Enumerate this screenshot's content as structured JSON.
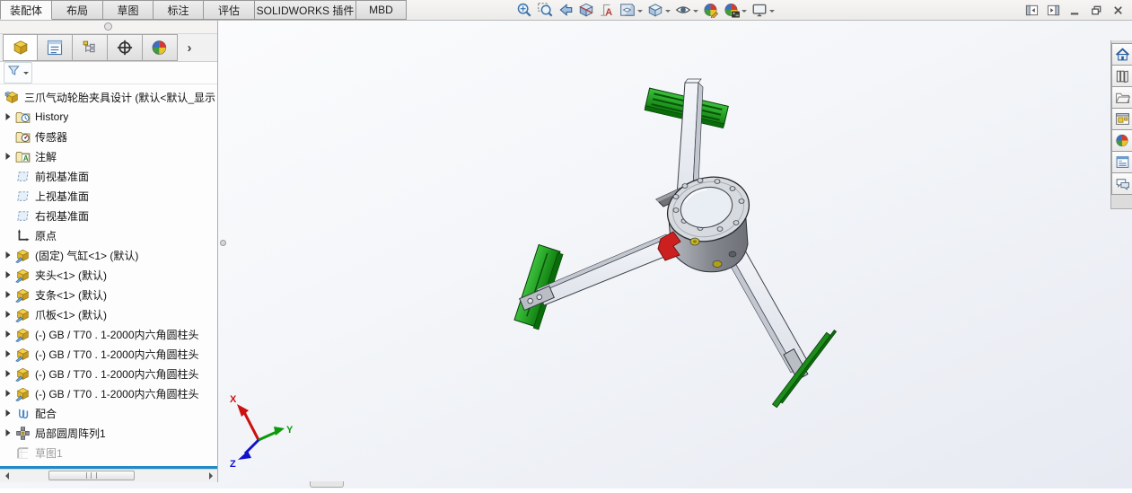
{
  "ribbon": {
    "tabs": [
      {
        "id": "assembly",
        "label": "装配体",
        "active": true
      },
      {
        "id": "layout",
        "label": "布局",
        "active": false
      },
      {
        "id": "sketch",
        "label": "草图",
        "active": false
      },
      {
        "id": "markup",
        "label": "标注",
        "active": false
      },
      {
        "id": "evaluate",
        "label": "评估",
        "active": false
      },
      {
        "id": "solidworks-addins",
        "label": "SOLIDWORKS 插件",
        "active": false
      },
      {
        "id": "mbd",
        "label": "MBD",
        "active": false
      }
    ]
  },
  "headsup": {
    "buttons": [
      {
        "id": "zoom-to-fit",
        "icon": "zoom-fit-icon",
        "dropdown": false
      },
      {
        "id": "zoom-to-area",
        "icon": "zoom-area-icon",
        "dropdown": false
      },
      {
        "id": "previous-view",
        "icon": "previous-view-icon",
        "dropdown": false
      },
      {
        "id": "section-view",
        "icon": "section-view-icon",
        "dropdown": false
      },
      {
        "id": "dynamic-annotation-views",
        "icon": "annotation-view-icon",
        "dropdown": false
      },
      {
        "id": "view-orientation",
        "icon": "view-orientation-icon",
        "dropdown": true
      },
      {
        "id": "display-style",
        "icon": "display-style-icon",
        "dropdown": true
      },
      {
        "id": "hide-show-items",
        "icon": "hide-show-items-icon",
        "dropdown": true
      },
      {
        "id": "edit-appearance",
        "icon": "edit-appearance-icon",
        "dropdown": false
      },
      {
        "id": "apply-scene",
        "icon": "apply-scene-icon",
        "dropdown": true
      },
      {
        "id": "view-settings",
        "icon": "view-settings-icon",
        "dropdown": true
      }
    ]
  },
  "window": {
    "controls": [
      {
        "id": "collapse-pane-left",
        "icon": "pane-left-icon"
      },
      {
        "id": "collapse-pane-right",
        "icon": "pane-right-icon"
      },
      {
        "id": "minimize",
        "icon": "minimize-icon"
      },
      {
        "id": "restore",
        "icon": "restore-icon"
      },
      {
        "id": "close",
        "icon": "close-icon"
      }
    ]
  },
  "fm_panel": {
    "tabs": [
      {
        "id": "featuremanager",
        "icon": "featuremanager-icon",
        "active": true
      },
      {
        "id": "propertymanager",
        "icon": "propertymanager-icon",
        "active": false
      },
      {
        "id": "configurationmanager",
        "icon": "configurationmanager-icon",
        "active": false
      },
      {
        "id": "dimxpert",
        "icon": "dimxpert-icon",
        "active": false
      },
      {
        "id": "displaymanager",
        "icon": "displaymanager-icon",
        "active": false
      }
    ],
    "overflow_chevron": "›",
    "root": {
      "name": "assembly-root",
      "icon": "assembly-icon",
      "label": "三爪气动轮胎夹具设计  (默认<默认_显示"
    },
    "items": [
      {
        "name": "history",
        "icon": "history-folder-icon",
        "label": "History",
        "arrow": true
      },
      {
        "name": "sensors",
        "icon": "sensors-folder-icon",
        "label": "传感器",
        "arrow": false
      },
      {
        "name": "annotations",
        "icon": "annotations-folder-icon",
        "label": "注解",
        "arrow": true
      },
      {
        "name": "front-plane",
        "icon": "plane-icon",
        "label": "前视基准面",
        "arrow": false
      },
      {
        "name": "top-plane",
        "icon": "plane-icon",
        "label": "上视基准面",
        "arrow": false
      },
      {
        "name": "right-plane",
        "icon": "plane-icon",
        "label": "右视基准面",
        "arrow": false
      },
      {
        "name": "origin",
        "icon": "origin-icon",
        "label": "原点",
        "arrow": false
      },
      {
        "name": "cylinder-component",
        "icon": "part-icon",
        "label": "(固定) 气缸<1> (默认)",
        "arrow": true
      },
      {
        "name": "chuck-component",
        "icon": "part-icon",
        "label": "夹头<1> (默认)",
        "arrow": true
      },
      {
        "name": "support-bar-component",
        "icon": "part-icon",
        "label": "支条<1> (默认)",
        "arrow": true
      },
      {
        "name": "claw-plate-component",
        "icon": "part-icon",
        "label": "爪板<1> (默认)",
        "arrow": true
      },
      {
        "name": "screw-1",
        "icon": "part-icon",
        "label": "(-) GB / T70 . 1-2000内六角圆柱头",
        "arrow": true
      },
      {
        "name": "screw-2",
        "icon": "part-icon",
        "label": "(-) GB / T70 . 1-2000内六角圆柱头",
        "arrow": true
      },
      {
        "name": "screw-3",
        "icon": "part-icon",
        "label": "(-) GB / T70 . 1-2000内六角圆柱头",
        "arrow": true
      },
      {
        "name": "screw-4",
        "icon": "part-icon",
        "label": "(-) GB / T70 . 1-2000内六角圆柱头",
        "arrow": true
      },
      {
        "name": "mates",
        "icon": "mates-icon",
        "label": "配合",
        "arrow": true
      },
      {
        "name": "circular-pattern",
        "icon": "pattern-icon",
        "label": "局部圆周阵列1",
        "arrow": true
      },
      {
        "name": "sketch1",
        "icon": "sketch-icon",
        "label": "草图1",
        "arrow": false,
        "grayed": true
      }
    ]
  },
  "taskpane": {
    "buttons": [
      {
        "id": "solidworks-resources",
        "icon": "home-icon"
      },
      {
        "id": "design-library",
        "icon": "design-library-icon"
      },
      {
        "id": "file-explorer",
        "icon": "file-explorer-icon"
      },
      {
        "id": "view-palette",
        "icon": "view-palette-icon"
      },
      {
        "id": "appearances-scenes",
        "icon": "appearances-icon"
      },
      {
        "id": "custom-properties",
        "icon": "custom-properties-icon"
      },
      {
        "id": "solidworks-forum",
        "icon": "forum-icon"
      }
    ]
  },
  "viewport": {
    "triad": {
      "x": "X",
      "y": "Y",
      "z": "Z"
    }
  },
  "colors": {
    "accent_blue": "#2089c6",
    "model_green": "#1e9e1e",
    "model_red": "#cc2020",
    "metal_gray": "#9a9da3"
  }
}
